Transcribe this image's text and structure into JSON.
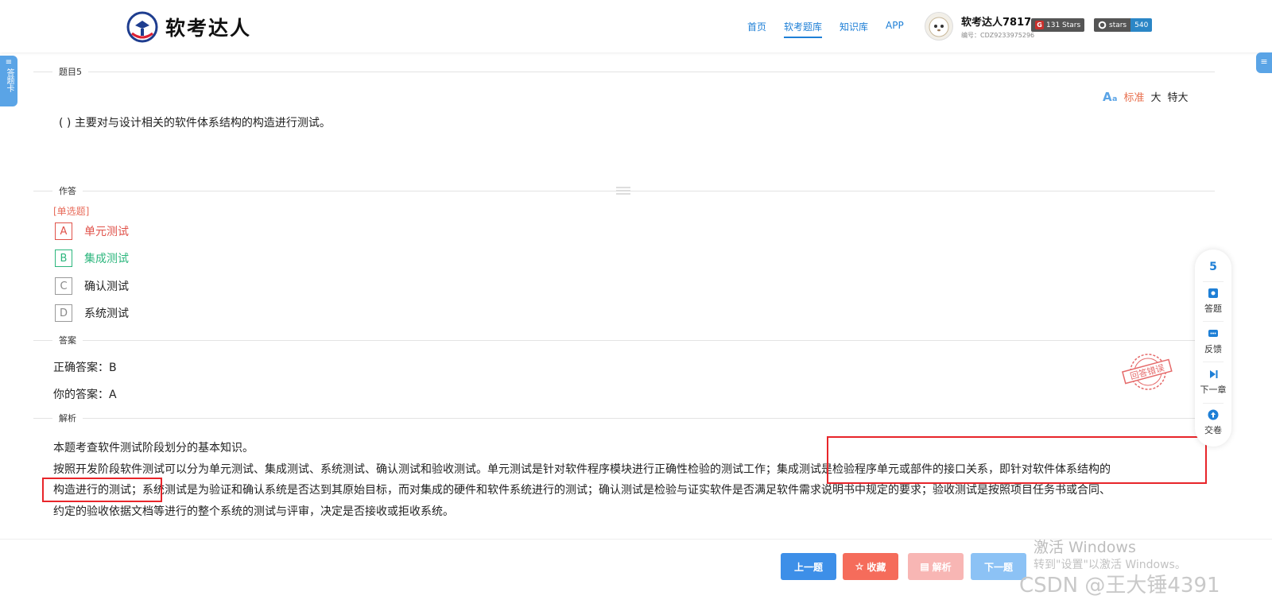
{
  "header": {
    "logo_text": "软考达人",
    "nav": [
      {
        "label": "首页",
        "active": false
      },
      {
        "label": "软考题库",
        "active": true
      },
      {
        "label": "知识库",
        "active": false
      },
      {
        "label": "APP",
        "active": false
      }
    ],
    "user": {
      "name": "软考达人7817",
      "code": "编号：CDZ9233975296"
    },
    "badges": [
      {
        "left_text": "131 Stars",
        "icon": "gitee-icon"
      },
      {
        "left_text": "stars",
        "right_text": "540",
        "icon": "github-icon"
      }
    ]
  },
  "side_tab": {
    "label": "答题卡"
  },
  "question": {
    "section_label": "题目5",
    "text": "( ) 主要对与设计相关的软件体系结构的构造进行测试。",
    "font_size": {
      "standard": "标准",
      "large": "大",
      "xlarge": "特大"
    }
  },
  "answer_section": {
    "label": "作答",
    "type": "[单选题]",
    "options": [
      {
        "letter": "A",
        "text": "单元测试",
        "state": "wrong"
      },
      {
        "letter": "B",
        "text": "集成测试",
        "state": "correct"
      },
      {
        "letter": "C",
        "text": "确认测试",
        "state": "none"
      },
      {
        "letter": "D",
        "text": "系统测试",
        "state": "none"
      }
    ]
  },
  "result_section": {
    "label": "答案",
    "correct": "正确答案：B",
    "yours": "你的答案：A",
    "stamp": "回答错误"
  },
  "analysis_section": {
    "label": "解析",
    "lines": [
      "本题考查软件测试阶段划分的基本知识。",
      "按照开发阶段软件测试可以分为单元测试、集成测试、系统测试、确认测试和验收测试。单元测试是针对软件程序模块进行正确性检验的测试工作；集成测试是检验程序单元或部件的接口关系，即针对软件体系结构的",
      "构造进行的测试；系统测试是为验证和确认系统是否达到其原始目标，而对集成的硬件和软件系统进行的测试；确认测试是检验与证实软件是否满足软件需求说明书中规定的要求；验收测试是按照项目任务书或合同、",
      "约定的验收依据文档等进行的整个系统的测试与评审，决定是否接收或拒收系统。"
    ]
  },
  "right_panel": {
    "number": "5",
    "items": [
      {
        "label": "答题",
        "icon": "answer-sheet-icon"
      },
      {
        "label": "反馈",
        "icon": "feedback-icon"
      },
      {
        "label": "下一章",
        "icon": "next-chapter-icon"
      },
      {
        "label": "交卷",
        "icon": "submit-icon"
      }
    ]
  },
  "footer": {
    "buttons": [
      {
        "label": "上一题",
        "color": "#3d8fe8"
      },
      {
        "label": "收藏",
        "color": "#f56c5b"
      },
      {
        "label": "解析",
        "color": "#f8b6b4"
      },
      {
        "label": "下一题",
        "color": "#8cc2f5"
      }
    ]
  },
  "watermark": {
    "line1": "激活 Windows",
    "line2": "转到\"设置\"以激活 Windows。",
    "csdn": "CSDN @王大锤4391"
  }
}
